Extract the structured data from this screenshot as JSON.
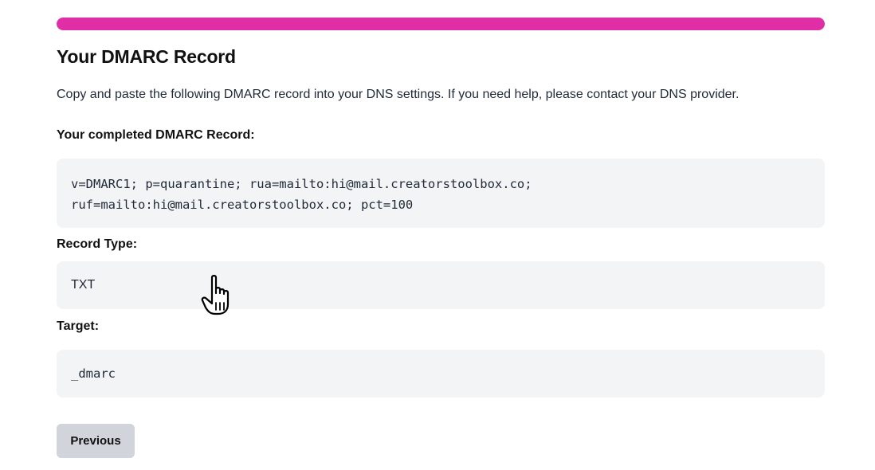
{
  "progress": {
    "fraction": 1.0,
    "color": "#e02fa6"
  },
  "header": {
    "title": "Your DMARC Record"
  },
  "intro": {
    "text": "Copy and paste the following DMARC record into your DNS settings. If you need help, please contact your DNS provider."
  },
  "record": {
    "label": "Your completed DMARC Record:",
    "line1": "v=DMARC1; p=quarantine; rua=mailto:hi@mail.creatorstoolbox.co;",
    "line2": "ruf=mailto:hi@mail.creatorstoolbox.co; pct=100"
  },
  "record_type": {
    "label": "Record Type:",
    "value": "TXT"
  },
  "target": {
    "label": "Target:",
    "value": "_dmarc"
  },
  "actions": {
    "previous_label": "Previous"
  },
  "cursor": {
    "icon": "hand-pointer-icon"
  }
}
